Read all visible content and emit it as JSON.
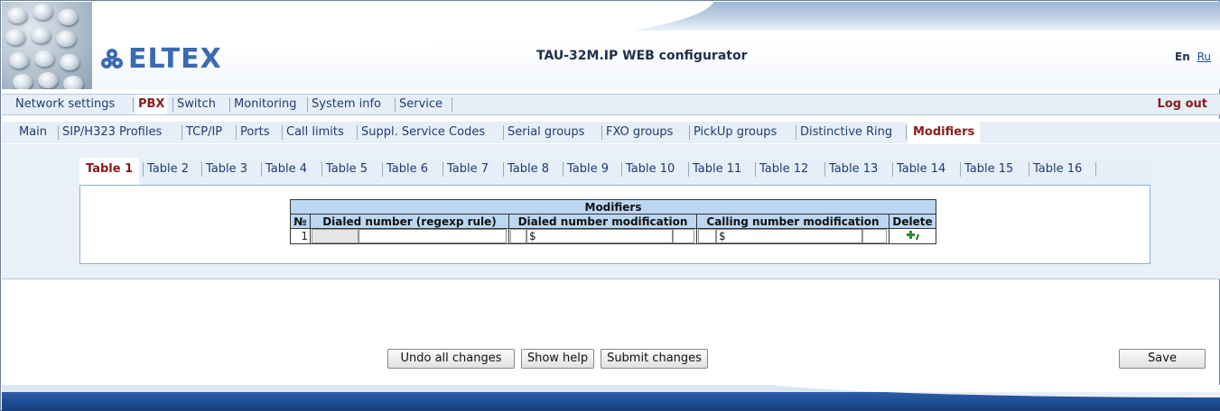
{
  "header": {
    "logo_text": "ELTEX",
    "app_title": "TAU-32M.IP WEB configurator",
    "lang_en": "En",
    "lang_ru": "Ru"
  },
  "main_menu": {
    "items": [
      {
        "label": "Network settings"
      },
      {
        "label": "PBX"
      },
      {
        "label": "Switch"
      },
      {
        "label": "Monitoring"
      },
      {
        "label": "System info"
      },
      {
        "label": "Service"
      }
    ],
    "active": "PBX",
    "logout": "Log out"
  },
  "sub_menu": {
    "items": [
      {
        "label": "Main"
      },
      {
        "label": "SIP/H323 Profiles"
      },
      {
        "label": "TCP/IP"
      },
      {
        "label": "Ports"
      },
      {
        "label": "Call limits"
      },
      {
        "label": "Suppl. Service Codes"
      },
      {
        "label": "Serial groups"
      },
      {
        "label": "FXO groups"
      },
      {
        "label": "PickUp groups"
      },
      {
        "label": "Distinctive Ring"
      },
      {
        "label": "Modifiers"
      }
    ],
    "active": "Modifiers"
  },
  "tabs": {
    "items": [
      {
        "label": "Table 1"
      },
      {
        "label": "Table 2"
      },
      {
        "label": "Table 3"
      },
      {
        "label": "Table 4"
      },
      {
        "label": "Table 5"
      },
      {
        "label": "Table 6"
      },
      {
        "label": "Table 7"
      },
      {
        "label": "Table 8"
      },
      {
        "label": "Table 9"
      },
      {
        "label": "Table 10"
      },
      {
        "label": "Table 11"
      },
      {
        "label": "Table 12"
      },
      {
        "label": "Table 13"
      },
      {
        "label": "Table 14"
      },
      {
        "label": "Table 15"
      },
      {
        "label": "Table 16"
      }
    ],
    "active": "Table 1"
  },
  "modifiers_table": {
    "title": "Modifiers",
    "columns": [
      "№",
      "Dialed number (regexp rule)",
      "Dialed number modification",
      "Calling number modification",
      "Delete"
    ],
    "rows": [
      {
        "index": "1",
        "dialed_regexp": "",
        "dialed_modification": "$",
        "calling_modification": "$"
      }
    ],
    "add_icon": "add-row-icon"
  },
  "buttons": {
    "undo": "Undo all changes",
    "help": "Show help",
    "submit": "Submit changes",
    "save": "Save"
  },
  "colors": {
    "active_text": "#8b1a1a",
    "menu_text": "#1e3c73",
    "table_header": "#bcd7f2",
    "footer_blue": "#1f4f98",
    "logo_blue": "#3a6ab3"
  }
}
